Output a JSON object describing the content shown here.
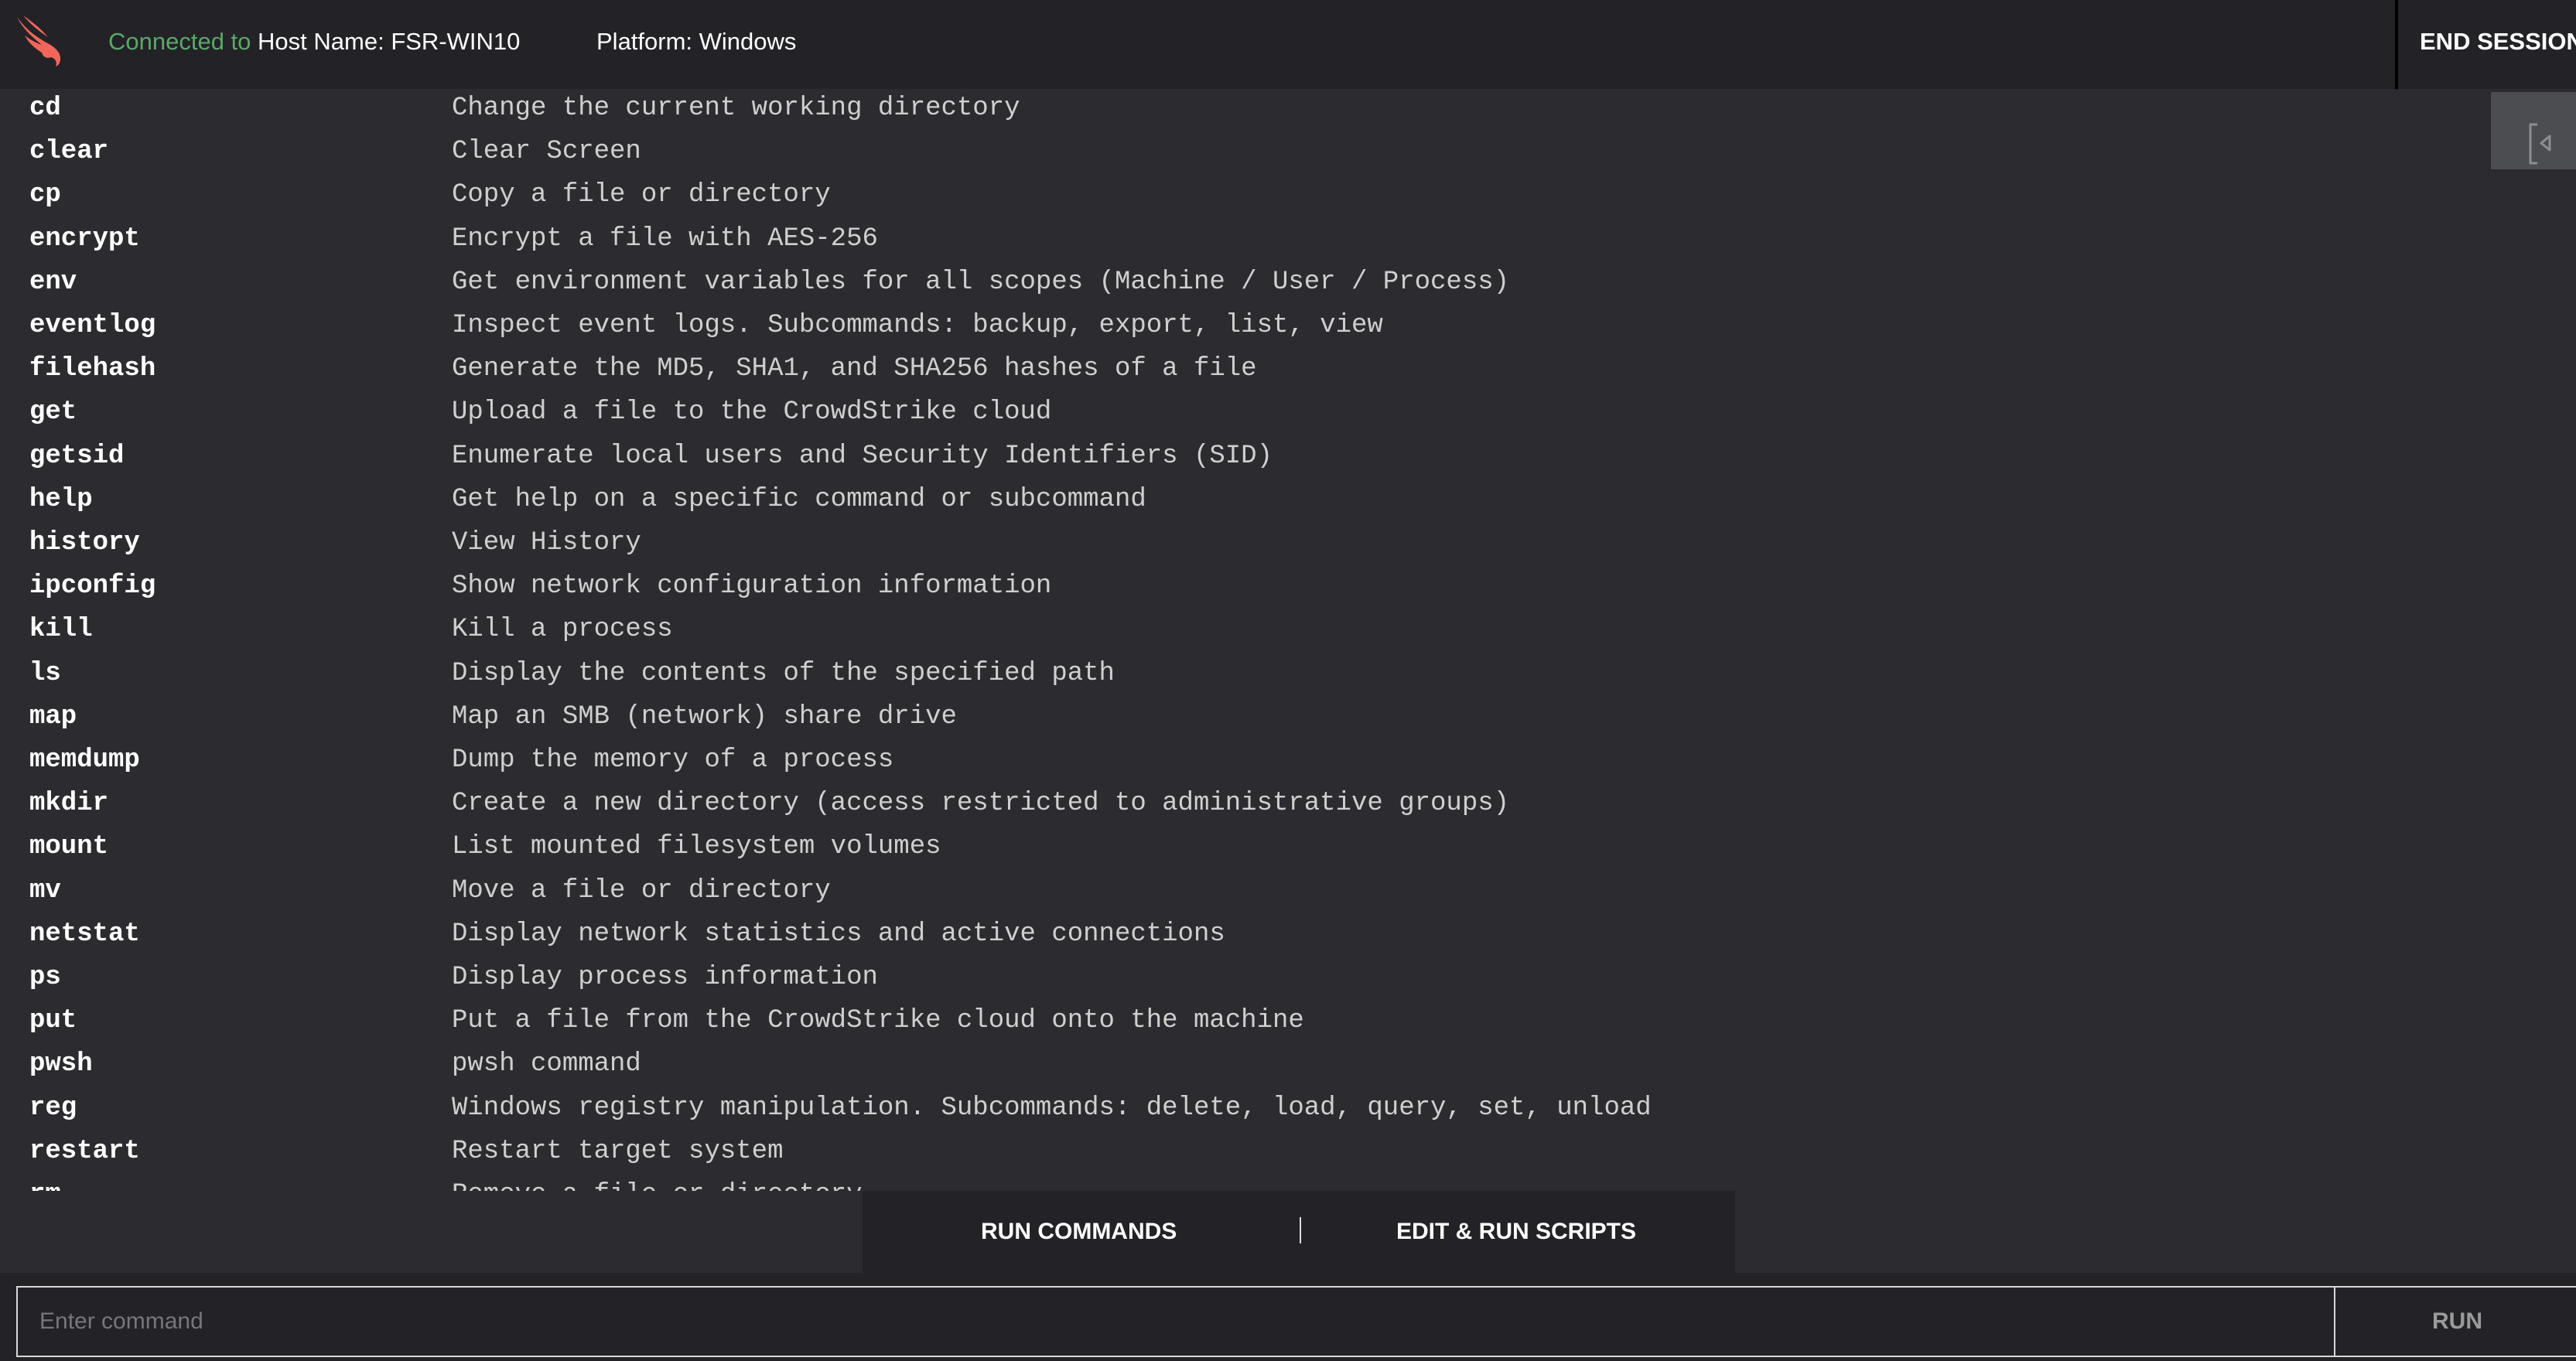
{
  "header": {
    "connected_prefix": "Connected to",
    "host": "Host Name: FSR-WIN10",
    "platform": "Platform: Windows",
    "end_session": "END SESSION",
    "logo_color": "#f0675a",
    "connected_color": "#5aa86a"
  },
  "commands": [
    {
      "name": "cd",
      "desc": "Change the current working directory"
    },
    {
      "name": "clear",
      "desc": "Clear Screen"
    },
    {
      "name": "cp",
      "desc": "Copy a file or directory"
    },
    {
      "name": "encrypt",
      "desc": "Encrypt a file with AES-256"
    },
    {
      "name": "env",
      "desc": "Get environment variables for all scopes (Machine / User / Process)"
    },
    {
      "name": "eventlog",
      "desc": "Inspect event logs. Subcommands: backup, export, list, view"
    },
    {
      "name": "filehash",
      "desc": "Generate the MD5, SHA1, and SHA256 hashes of a file"
    },
    {
      "name": "get",
      "desc": "Upload a file to the CrowdStrike cloud"
    },
    {
      "name": "getsid",
      "desc": "Enumerate local users and Security Identifiers (SID)"
    },
    {
      "name": "help",
      "desc": "Get help on a specific command or subcommand"
    },
    {
      "name": "history",
      "desc": "View History"
    },
    {
      "name": "ipconfig",
      "desc": "Show network configuration information"
    },
    {
      "name": "kill",
      "desc": "Kill a process"
    },
    {
      "name": "ls",
      "desc": "Display the contents of the specified path"
    },
    {
      "name": "map",
      "desc": "Map an SMB (network) share drive"
    },
    {
      "name": "memdump",
      "desc": "Dump the memory of a process"
    },
    {
      "name": "mkdir",
      "desc": "Create a new directory (access restricted to administrative groups)"
    },
    {
      "name": "mount",
      "desc": "List mounted filesystem volumes"
    },
    {
      "name": "mv",
      "desc": "Move a file or directory"
    },
    {
      "name": "netstat",
      "desc": "Display network statistics and active connections"
    },
    {
      "name": "ps",
      "desc": "Display process information"
    },
    {
      "name": "put",
      "desc": "Put a file from the CrowdStrike cloud onto the machine"
    },
    {
      "name": "pwsh",
      "desc": "pwsh command"
    },
    {
      "name": "reg",
      "desc": "Windows registry manipulation. Subcommands: delete, load, query, set, unload"
    },
    {
      "name": "restart",
      "desc": "Restart target system"
    },
    {
      "name": "rm",
      "desc": "Remove a file or directory"
    }
  ],
  "side_button_icon": "collapse-panel-icon",
  "tabs": {
    "run_commands": "RUN COMMANDS",
    "edit_run_scripts": "EDIT & RUN SCRIPTS"
  },
  "command_input": {
    "placeholder": "Enter command",
    "value": ""
  },
  "run_label": "RUN"
}
